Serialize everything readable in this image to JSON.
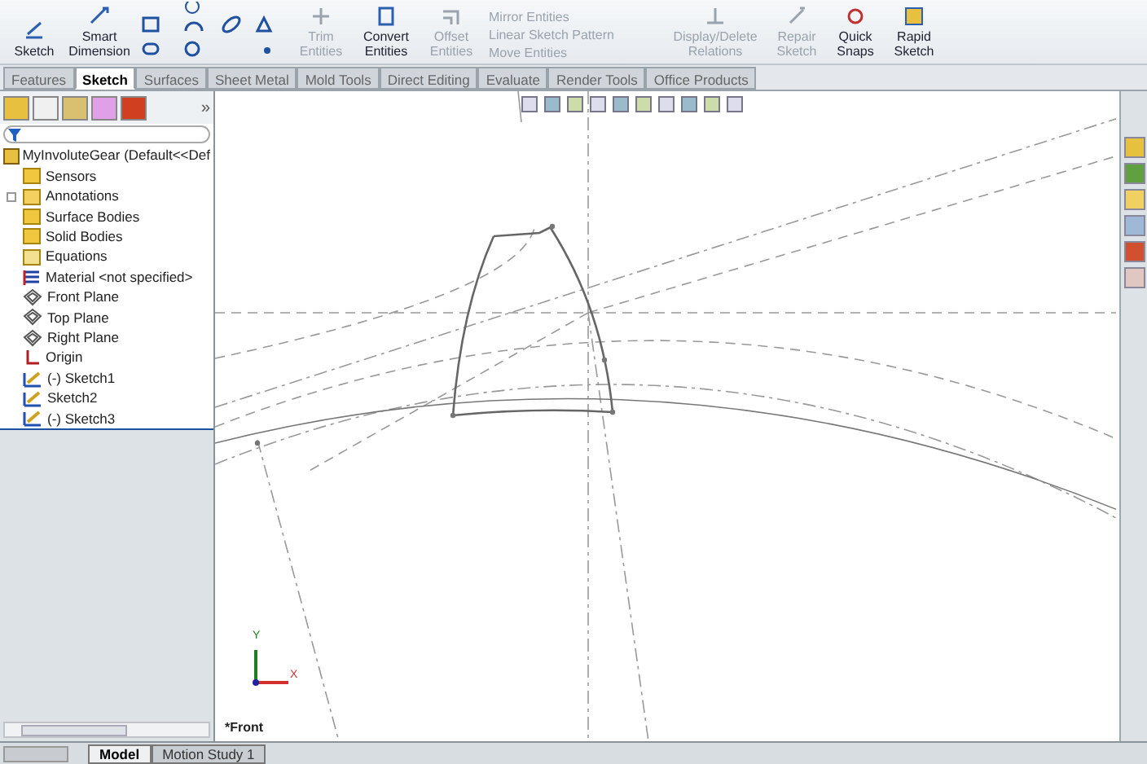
{
  "ribbon": {
    "large_buttons": [
      {
        "label": "Sketch",
        "disabled": false,
        "kind": "sketch"
      },
      {
        "label": "Smart Dimension",
        "disabled": false,
        "kind": "dimension"
      }
    ],
    "mid_buttons": [
      {
        "label": "Trim Entities",
        "disabled": true,
        "kind": "trim"
      },
      {
        "label": "Convert Entities",
        "disabled": false,
        "kind": "convert"
      },
      {
        "label": "Offset Entities",
        "disabled": true,
        "kind": "offset"
      }
    ],
    "list_buttons": [
      {
        "label": "Mirror Entities",
        "disabled": true
      },
      {
        "label": "Linear Sketch Pattern",
        "disabled": true
      },
      {
        "label": "Move Entities",
        "disabled": true
      }
    ],
    "right_buttons": [
      {
        "label": "Display/Delete Relations",
        "disabled": true,
        "kind": "relations"
      },
      {
        "label": "Repair Sketch",
        "disabled": true,
        "kind": "repair"
      },
      {
        "label": "Quick Snaps",
        "disabled": false,
        "kind": "snaps"
      },
      {
        "label": "Rapid Sketch",
        "disabled": false,
        "kind": "rapid"
      }
    ]
  },
  "command_tabs": [
    {
      "label": "Features",
      "selected": false
    },
    {
      "label": "Sketch",
      "selected": true
    },
    {
      "label": "Surfaces",
      "selected": false
    },
    {
      "label": "Sheet Metal",
      "selected": false
    },
    {
      "label": "Mold Tools",
      "selected": false
    },
    {
      "label": "Direct Editing",
      "selected": false
    },
    {
      "label": "Evaluate",
      "selected": false
    },
    {
      "label": "Render Tools",
      "selected": false
    },
    {
      "label": "Office Products",
      "selected": false
    }
  ],
  "panel_more": "»",
  "feature_tree": {
    "root": "MyInvoluteGear  (Default<<Def",
    "children": [
      {
        "label": "Sensors",
        "kind": "folder",
        "has_children": false
      },
      {
        "label": "Annotations",
        "kind": "annotation",
        "has_children": true
      },
      {
        "label": "Surface Bodies",
        "kind": "folder",
        "has_children": false
      },
      {
        "label": "Solid Bodies",
        "kind": "folder",
        "has_children": false
      },
      {
        "label": "Equations",
        "kind": "equation",
        "has_children": false
      },
      {
        "label": "Material <not specified>",
        "kind": "material",
        "has_children": false
      },
      {
        "label": "Front Plane",
        "kind": "plane",
        "has_children": false
      },
      {
        "label": "Top Plane",
        "kind": "plane",
        "has_children": false
      },
      {
        "label": "Right Plane",
        "kind": "plane",
        "has_children": false
      },
      {
        "label": "Origin",
        "kind": "origin",
        "has_children": false
      },
      {
        "label": "(-) Sketch1",
        "kind": "sketch",
        "has_children": false
      },
      {
        "label": "Sketch2",
        "kind": "sketch",
        "has_children": false
      },
      {
        "label": "(-) Sketch3",
        "kind": "sketch",
        "has_children": false
      }
    ]
  },
  "viewport": {
    "view_label": "*Front",
    "axis_x": "X",
    "axis_y": "Y"
  },
  "bottom_tabs": [
    {
      "label": "Model",
      "selected": true
    },
    {
      "label": "Motion Study 1",
      "selected": false
    }
  ]
}
